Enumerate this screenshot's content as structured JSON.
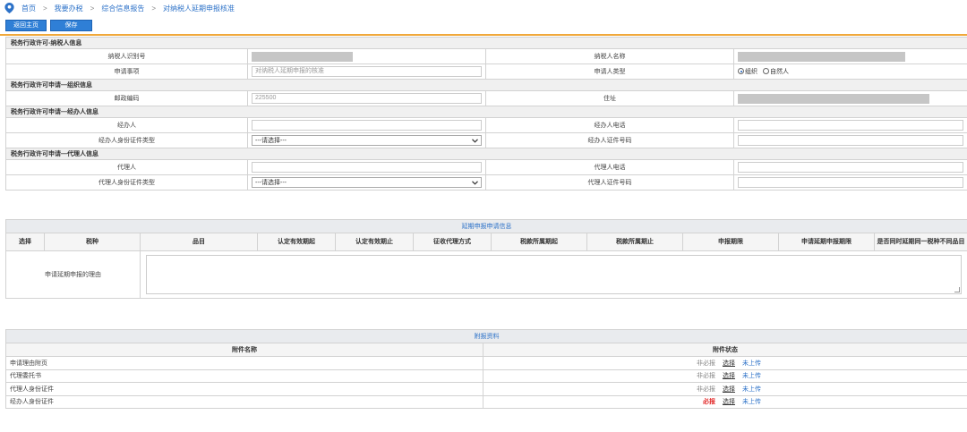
{
  "breadcrumb": {
    "home": "首页",
    "sep": ">",
    "level1": "我要办税",
    "level2": "综合信息报告",
    "level3": "对纳税人延期申报核准"
  },
  "buttons": {
    "back_home": "返回主页",
    "save": "保存"
  },
  "taxpayer_section": {
    "title": "税务行政许可-纳税人信息",
    "taxpayer_id_label": "纳税人识别号",
    "taxpayer_name_label": "纳税人名称",
    "matter_label": "申请事项",
    "matter_value": "对纳税人延期申报的核准",
    "applicant_type_label": "申请人类型",
    "applicant_type_options": [
      "组织",
      "自然人"
    ],
    "applicant_type_selected": "组织"
  },
  "org_section": {
    "title": "税务行政许可申请—组织信息",
    "postal_label": "邮政编码",
    "postal_value": "225500",
    "address_label": "住址"
  },
  "handler_section": {
    "title": "税务行政许可申请—经办人信息",
    "handler_label": "经办人",
    "handler_phone_label": "经办人电话",
    "handler_id_type_label": "经办人身份证件类型",
    "handler_id_type_value": "---请选择---",
    "handler_id_no_label": "经办人证件号码"
  },
  "agent_section": {
    "title": "税务行政许可申请—代理人信息",
    "agent_label": "代理人",
    "agent_phone_label": "代理人电话",
    "agent_id_type_label": "代理人身份证件类型",
    "agent_id_type_value": "---请选择---",
    "agent_id_no_label": "代理人证件号码"
  },
  "extension": {
    "title": "延期申报申请信息",
    "columns": [
      "选择",
      "税种",
      "品目",
      "认定有效期起",
      "认定有效期止",
      "征收代理方式",
      "税款所属期起",
      "税款所属期止",
      "申报期限",
      "申请延期申报期限",
      "是否同时延期同一税种不同品目"
    ],
    "reason_label": "申请延期申报的理由"
  },
  "attachments": {
    "title": "附报资料",
    "col_name": "附件名称",
    "col_status": "附件状态",
    "choose_label": "选择",
    "rows": [
      {
        "name": "申请理由附页",
        "req": "非必报",
        "status": "未上传"
      },
      {
        "name": "代理委托书",
        "req": "非必报",
        "status": "未上传"
      },
      {
        "name": "代理人身份证件",
        "req": "非必报",
        "status": "未上传"
      },
      {
        "name": "经办人身份证件",
        "req": "必报",
        "status": "未上传"
      }
    ]
  },
  "colors": {
    "accent": "#2f7fd6",
    "topline": "#f0a83b",
    "required": "#e22b2b",
    "link": "#2d72c8"
  },
  "icons": {
    "location": "location-pin-icon",
    "dropdown": "chevron-down-icon"
  }
}
